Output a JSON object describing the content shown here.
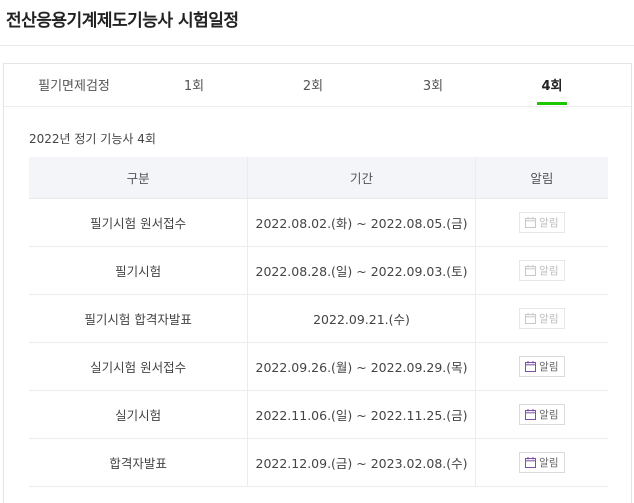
{
  "page": {
    "title": "전산응용기계제도기능사 시험일정"
  },
  "tabs": [
    {
      "label": "필기면제검정",
      "active": false
    },
    {
      "label": "1회",
      "active": false
    },
    {
      "label": "2회",
      "active": false
    },
    {
      "label": "3회",
      "active": false
    },
    {
      "label": "4회",
      "active": true
    }
  ],
  "section": {
    "subtitle": "2022년 정기 기능사 4회"
  },
  "table": {
    "headers": [
      "구분",
      "기간",
      "알림"
    ],
    "rows": [
      {
        "category": "필기시험 원서접수",
        "period": "2022.08.02.(화) ~ 2022.08.05.(금)",
        "alarm": "알림",
        "alarm_enabled": false
      },
      {
        "category": "필기시험",
        "period": "2022.08.28.(일) ~ 2022.09.03.(토)",
        "alarm": "알림",
        "alarm_enabled": false
      },
      {
        "category": "필기시험 합격자발표",
        "period": "2022.09.21.(수)",
        "alarm": "알림",
        "alarm_enabled": false
      },
      {
        "category": "실기시험 원서접수",
        "period": "2022.09.26.(월) ~ 2022.09.29.(목)",
        "alarm": "알림",
        "alarm_enabled": true
      },
      {
        "category": "실기시험",
        "period": "2022.11.06.(일) ~ 2022.11.25.(금)",
        "alarm": "알림",
        "alarm_enabled": true
      },
      {
        "category": "합격자발표",
        "period": "2022.12.09.(금) ~ 2023.02.08.(수)",
        "alarm": "알림",
        "alarm_enabled": true
      }
    ]
  },
  "colors": {
    "active_tab_underline": "#1ec800",
    "calendar_icon_active": "#7b4fa6",
    "calendar_icon_disabled": "#c8c8c8"
  },
  "icons": {
    "alarm": "calendar-icon"
  }
}
